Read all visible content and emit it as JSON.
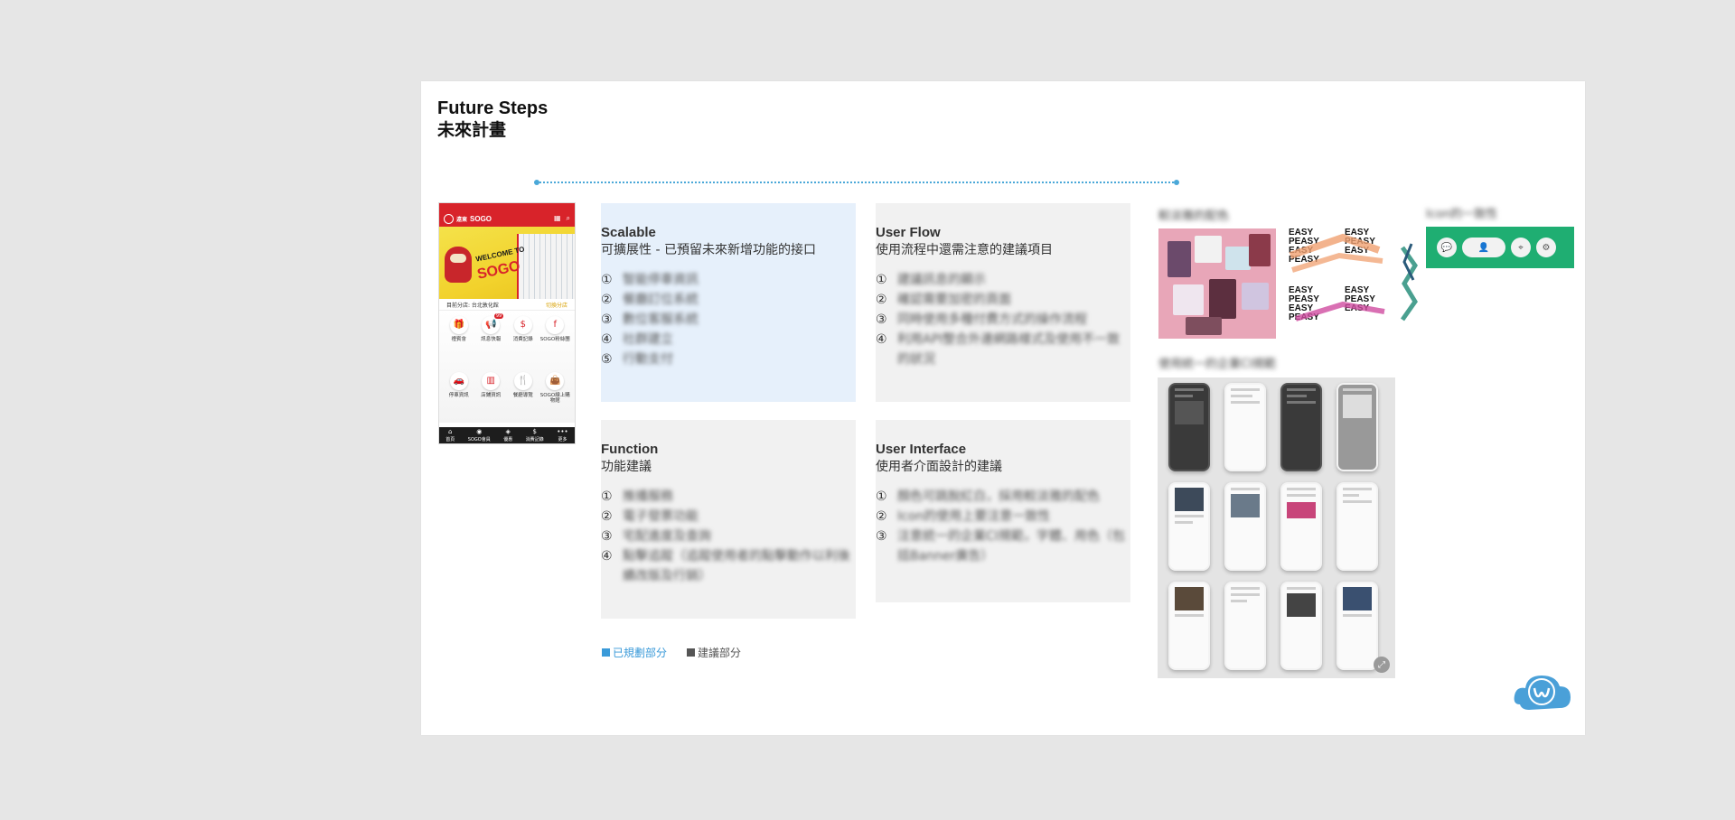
{
  "title": {
    "en": "Future Steps",
    "zh": "未來計畫"
  },
  "phone": {
    "header_brand": "SOGO",
    "header_small": "遠東",
    "banner_welcome": "WELCOME TO",
    "banner_brand": "SOGO",
    "location_label": "目前分店: 台北敦化館",
    "switch_label": "切換分店",
    "grid": [
      {
        "label": "禮賓會",
        "icon": "gift-icon",
        "glyph": "🎁"
      },
      {
        "label": "訊息快報",
        "icon": "megaphone-icon",
        "glyph": "📢",
        "badge": "99"
      },
      {
        "label": "消費記錄",
        "icon": "receipt-icon",
        "glyph": "$"
      },
      {
        "label": "SOGO粉絲團",
        "icon": "facebook-icon",
        "glyph": "f"
      },
      {
        "label": "停車資訊",
        "icon": "car-icon",
        "glyph": "🚗"
      },
      {
        "label": "店鋪資訊",
        "icon": "building-icon",
        "glyph": "▥"
      },
      {
        "label": "餐廳導覽",
        "icon": "dining-icon",
        "glyph": "🍴"
      },
      {
        "label": "SOGO線上購物館",
        "icon": "shopping-bag-icon",
        "glyph": "👜"
      }
    ],
    "tabs": [
      {
        "label": "首頁",
        "glyph": "⌂",
        "badge": "14"
      },
      {
        "label": "SOGO會員",
        "glyph": "◉"
      },
      {
        "label": "優惠",
        "glyph": "◈"
      },
      {
        "label": "消費記錄",
        "glyph": "$"
      },
      {
        "label": "更多",
        "glyph": "•••"
      }
    ]
  },
  "cards": [
    {
      "title": "Scalable",
      "subtitle": "可擴展性 - 已預留未來新增功能的接口",
      "variant": "planned",
      "items": [
        {
          "n": "①",
          "t": "智能停車資訊"
        },
        {
          "n": "②",
          "t": "餐廳訂位系統"
        },
        {
          "n": "③",
          "t": "數位客服系統"
        },
        {
          "n": "④",
          "t": "社群建立"
        },
        {
          "n": "⑤",
          "t": "行動支付"
        }
      ]
    },
    {
      "title": "User Flow",
      "subtitle": "使用流程中還需注意的建議項目",
      "variant": "suggested",
      "items": [
        {
          "n": "①",
          "t": "建議訊息的顯示"
        },
        {
          "n": "②",
          "t": "確認需要加密的頁面"
        },
        {
          "n": "③",
          "t": "同時使用多種付費方式的操作流程"
        },
        {
          "n": "④",
          "t": "利用API整合外連網路樣式及使用不一致的狀況"
        }
      ]
    },
    {
      "title": "Function",
      "subtitle": "功能建議",
      "variant": "suggested",
      "items": [
        {
          "n": "①",
          "t": "推播服務"
        },
        {
          "n": "②",
          "t": "電子發票功能"
        },
        {
          "n": "③",
          "t": "宅配進度及查詢"
        },
        {
          "n": "④",
          "t": "點擊追蹤（追蹤使用者的點擊動作以利後續改版及行銷）"
        }
      ]
    },
    {
      "title": "User Interface",
      "subtitle": "使用者介面設計的建議",
      "variant": "suggested",
      "items": [
        {
          "n": "①",
          "t": "顏色可跳脫紅白，採用較淡雅的配色"
        },
        {
          "n": "②",
          "t": "Icon的使用上要注意一致性"
        },
        {
          "n": "③",
          "t": "注意統一的企業CI規範，字體、用色（包括Banner廣告）"
        }
      ]
    }
  ],
  "legend": [
    {
      "label": "已規劃部分",
      "color": "#3a9ad9"
    },
    {
      "label": "建議部分",
      "color": "#555555"
    }
  ],
  "right": {
    "label_palette": "較淡雅的配色",
    "label_icons": "Icon的一致性",
    "label_ci": "使用統一的企業CI規範",
    "poster_lines": [
      "EASY",
      "PEASY",
      "EASY",
      "PEASY"
    ]
  },
  "colors": {
    "planned_bg": "#e6f0fb",
    "suggested_bg": "#f1f1f1",
    "accent_line": "#4aa8d8",
    "icon_bar": "#1fae72",
    "brand_red": "#d8232a"
  }
}
